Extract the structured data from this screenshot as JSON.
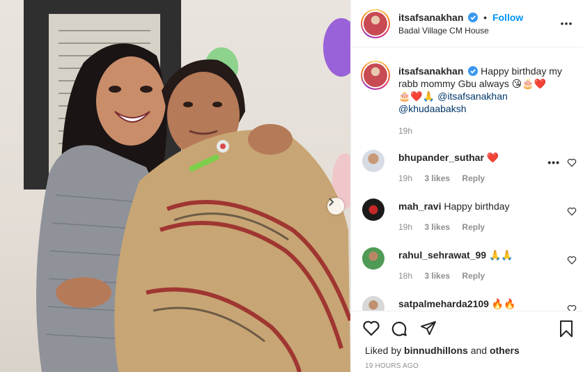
{
  "post": {
    "username": "itsafsanakhan",
    "follow_label": "Follow",
    "location": "Badal Village CM House",
    "separator": "•",
    "more_icon": "more-horizontal-icon"
  },
  "caption": {
    "username": "itsafsanakhan",
    "text_line1": "Happy birthday my rabb mommy Gbu always 😘🎂❤️",
    "text_line2": "🎂❤️🙏",
    "mention1": "@itsafsanakhan",
    "mention2": "@khudaabaksh",
    "time": "19h"
  },
  "comments": [
    {
      "username": "bhupander_suthar",
      "text": "❤️",
      "time": "19h",
      "likes": "3 likes",
      "reply": "Reply",
      "show_more": "•••"
    },
    {
      "username": "mah_ravi",
      "text": "Happy birthday",
      "time": "19h",
      "likes": "3 likes",
      "reply": "Reply"
    },
    {
      "username": "rahul_sehrawat_99",
      "text": "🙏🙏",
      "time": "18h",
      "likes": "3 likes",
      "reply": "Reply"
    },
    {
      "username": "satpalmeharda2109",
      "text": "🔥🔥",
      "time": "",
      "likes": "",
      "reply": ""
    }
  ],
  "footer": {
    "liked_by_prefix": "Liked by",
    "liked_by_user": "binnudhillons",
    "liked_by_and": "and",
    "liked_by_others": "others",
    "timestamp": "19 HOURS AGO"
  },
  "colors": {
    "accent": "#0095f6",
    "text": "#262626",
    "muted": "#8e8e8e",
    "mention": "#00376b",
    "border": "#efefef"
  }
}
